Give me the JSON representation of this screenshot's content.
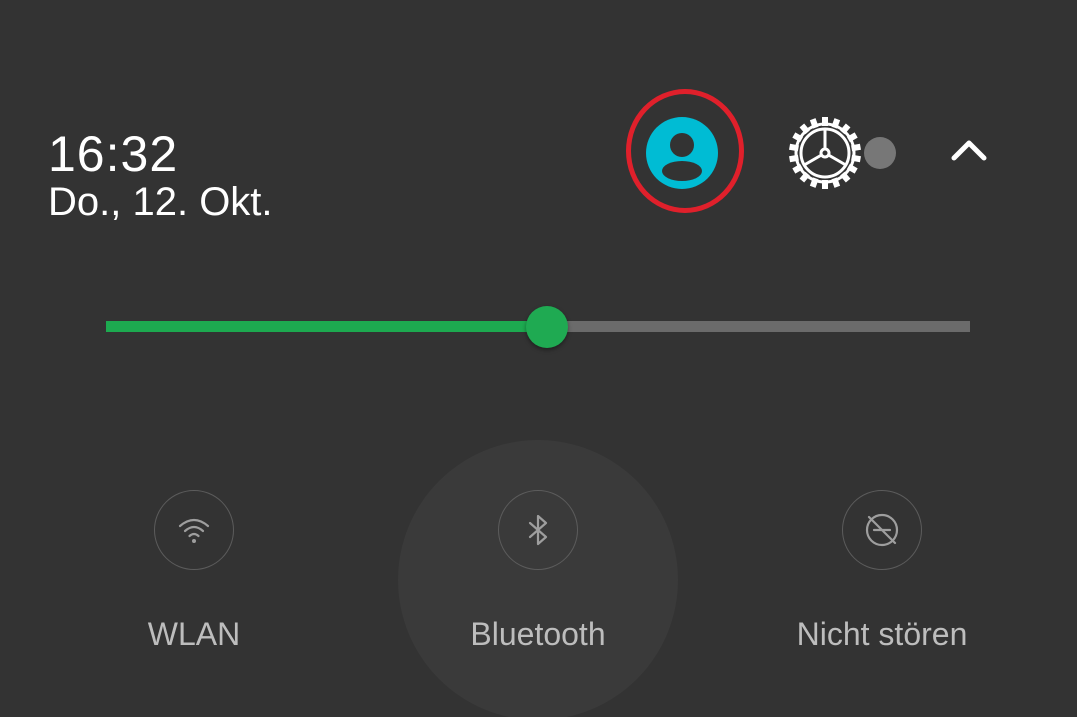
{
  "header": {
    "time": "16:32",
    "date": "Do., 12. Okt."
  },
  "icons": {
    "user": "account-circle-icon",
    "settings": "gear-icon",
    "collapse": "chevron-up-icon",
    "wifi": "wifi-icon",
    "bluetooth": "bluetooth-icon",
    "dnd": "do-not-disturb-icon"
  },
  "brightness": {
    "level_percent": 51
  },
  "tiles": [
    {
      "label": "WLAN",
      "active": false
    },
    {
      "label": "Bluetooth",
      "active": false
    },
    {
      "label": "Nicht stören",
      "active": false
    }
  ],
  "colors": {
    "background": "#333333",
    "accent_green": "#1daa50",
    "user_icon": "#00bcd4",
    "highlight_ring": "#e0202b"
  }
}
